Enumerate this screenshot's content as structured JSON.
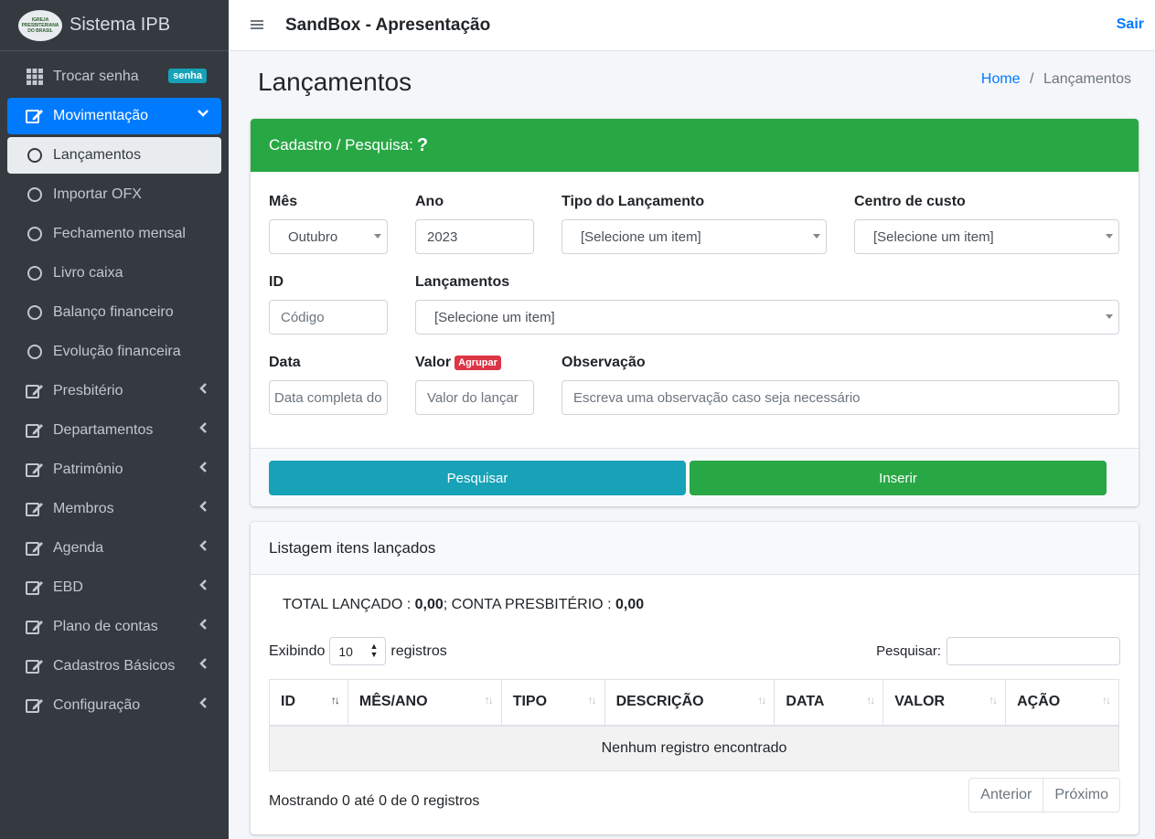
{
  "brand": {
    "name": "Sistema IPB",
    "logo_text": "IGREJA PRESBITERIANA DO BRASIL"
  },
  "header": {
    "title": "SandBox - Apresentação",
    "logout": "Sair"
  },
  "sidebar": {
    "items": [
      {
        "label": "Trocar senha",
        "badge": "senha"
      },
      {
        "label": "Movimentação"
      },
      {
        "label": "Lançamentos"
      },
      {
        "label": "Importar OFX"
      },
      {
        "label": "Fechamento mensal"
      },
      {
        "label": "Livro caixa"
      },
      {
        "label": "Balanço financeiro"
      },
      {
        "label": "Evolução financeira"
      },
      {
        "label": "Presbitério"
      },
      {
        "label": "Departamentos"
      },
      {
        "label": "Patrimônio"
      },
      {
        "label": "Membros"
      },
      {
        "label": "Agenda"
      },
      {
        "label": "EBD"
      },
      {
        "label": "Plano de contas"
      },
      {
        "label": "Cadastros Básicos"
      },
      {
        "label": "Configuração"
      }
    ]
  },
  "page": {
    "title": "Lançamentos",
    "breadcrumb_home": "Home",
    "breadcrumb_sep": "/",
    "breadcrumb_current": "Lançamentos"
  },
  "form": {
    "header": "Cadastro / Pesquisa:",
    "help": "?",
    "mes_label": "Mês",
    "mes_value": "Outubro",
    "ano_label": "Ano",
    "ano_value": "2023",
    "tipo_label": "Tipo do Lançamento",
    "tipo_value": "[Selecione um item]",
    "centro_label": "Centro de custo",
    "centro_value": "[Selecione um item]",
    "id_label": "ID",
    "id_placeholder": "Código",
    "lanc_label": "Lançamentos",
    "lanc_value": "[Selecione um item]",
    "data_label": "Data",
    "data_placeholder": "Data completa do",
    "valor_label": "Valor",
    "valor_badge": "Agrupar",
    "valor_placeholder": "Valor do lançar",
    "obs_label": "Observação",
    "obs_placeholder": "Escreva uma observação caso seja necessário",
    "search_btn": "Pesquisar",
    "insert_btn": "Inserir",
    "colors": {
      "search": "#17a2b8",
      "insert": "#28a745",
      "header": "#28a745"
    }
  },
  "listing": {
    "header": "Listagem itens lançados",
    "total_label": "TOTAL LANÇADO :",
    "total_value": "0,00",
    "conta_label": "; CONTA PRESBITÉRIO :",
    "conta_value": "0,00",
    "show_label": "Exibindo",
    "show_value": "10",
    "show_suffix": "registros",
    "search_label": "Pesquisar:",
    "columns": [
      "ID",
      "MÊS/ANO",
      "TIPO",
      "DESCRIÇÃO",
      "DATA",
      "VALOR",
      "AÇÃO"
    ],
    "empty": "Nenhum registro encontrado",
    "info": "Mostrando 0 até 0 de 0 registros",
    "prev": "Anterior",
    "next": "Próximo"
  }
}
